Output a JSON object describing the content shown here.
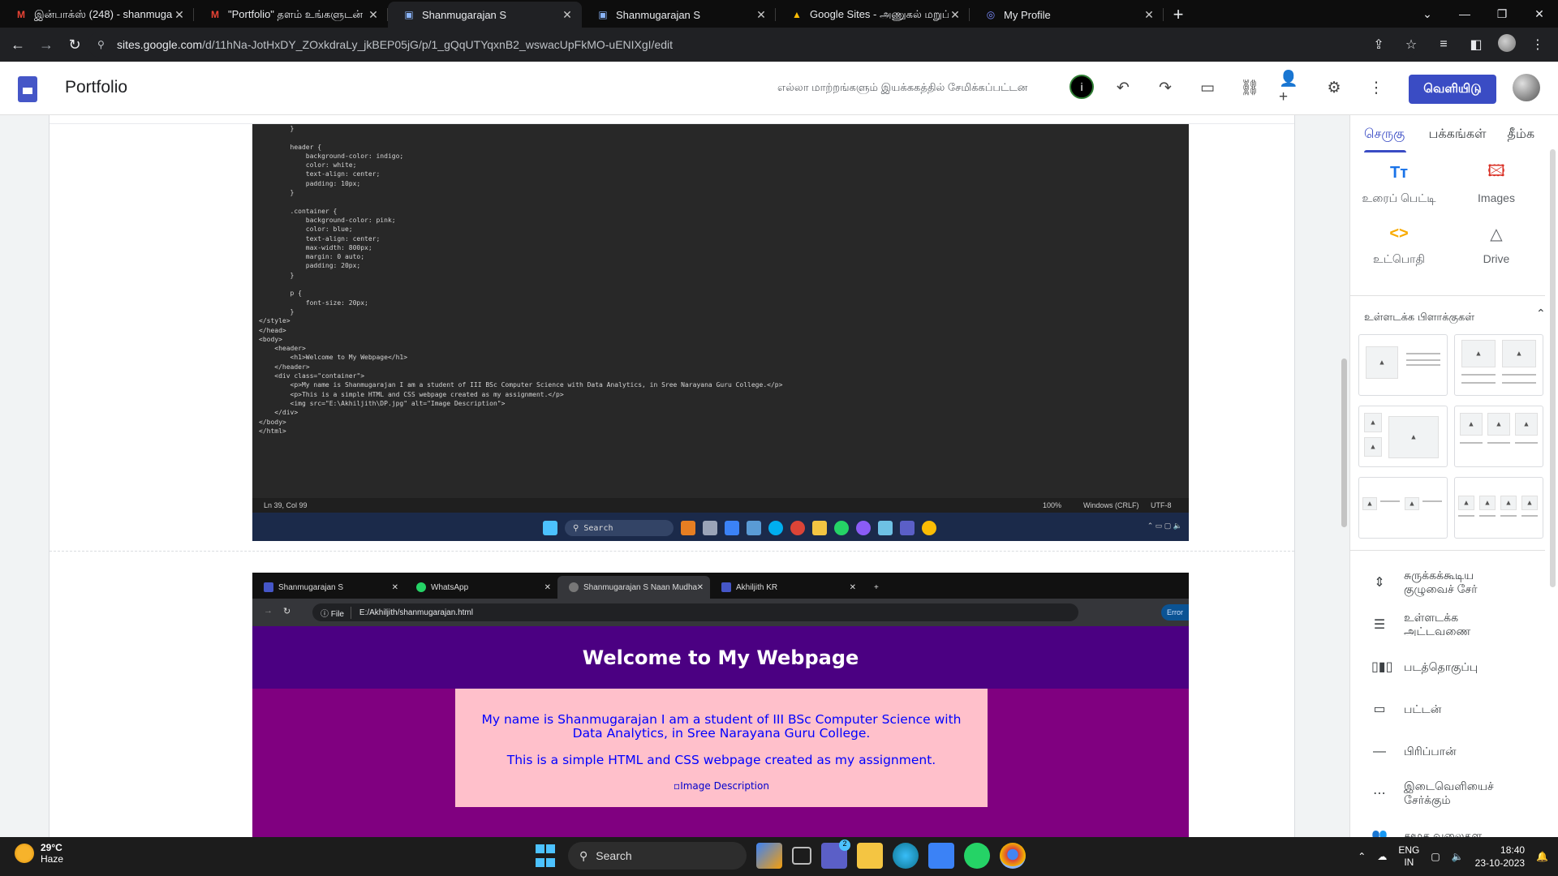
{
  "browser": {
    "tabs": [
      {
        "title": "இன்பாக்ஸ் (248) - shanmugara",
        "icon": "gmail-icon",
        "active": false
      },
      {
        "title": "\"Portfolio\" தளம் உங்களுடன்",
        "icon": "gmail-icon",
        "active": false
      },
      {
        "title": "Shanmugarajan S",
        "icon": "google-sites-icon",
        "active": true
      },
      {
        "title": "Shanmugarajan S",
        "icon": "google-sites-icon",
        "active": false
      },
      {
        "title": "Google Sites - அணுகல் மறுப்",
        "icon": "google-drive-icon",
        "active": false
      },
      {
        "title": "My Profile",
        "icon": "profile-icon",
        "active": false
      }
    ],
    "url_domain": "sites.google.com",
    "url_path": "/d/11hNa-JotHxDY_ZOxkdraLy_jkBEP05jG/p/1_gQqUTYqxnB2_wswacUpFkMO-uENIXgI/edit"
  },
  "sites": {
    "site_name": "Portfolio",
    "saved_status": "எல்லா மாற்றங்களும் இயக்ககத்தில் சேமிக்கப்பட்டன",
    "publish_label": "வெளியிடு"
  },
  "code_screenshot": {
    "lines": [
      "        }",
      "",
      "        header {",
      "            background-color: indigo;",
      "            color: white;",
      "            text-align: center;",
      "            padding: 10px;",
      "        }",
      "",
      "        .container {",
      "            background-color: pink;",
      "            color: blue;",
      "            text-align: center;",
      "            max-width: 800px;",
      "            margin: 0 auto;",
      "            padding: 20px;",
      "        }",
      "",
      "        p {",
      "            font-size: 20px;",
      "        }",
      "</style>",
      "</head>",
      "<body>",
      "    <header>",
      "        <h1>Welcome to My Webpage</h1>",
      "    </header>",
      "    <div class=\"container\">",
      "        <p>My name is Shanmugarajan I am a student of III BSc Computer Science with Data Analytics, in Sree Narayana Guru College.</p>",
      "        <p>This is a simple HTML and CSS webpage created as my assignment.</p>",
      "        <img src=\"E:\\Akhiljith\\DP.jpg\" alt=\"Image Description\">",
      "    </div>",
      "</body>",
      "</html>"
    ],
    "status_position": "Ln 39, Col 99",
    "status_zoom": "100%",
    "status_eol": "Windows (CRLF)",
    "status_encoding": "UTF-8",
    "taskbar_search": "Search"
  },
  "browser_screenshot": {
    "tabs": [
      "Shanmugarajan S",
      "WhatsApp",
      "Shanmugarajan S Naan Mudhalvan",
      "Akhiljith KR"
    ],
    "file_label": "File",
    "url": "E:/Akhiljith/shanmugarajan.html",
    "error_label": "Error",
    "heading": "Welcome to My Webpage",
    "paragraph1": "My name is Shanmugarajan I am a student of III BSc Computer Science with Data Analytics, in Sree Narayana Guru College.",
    "paragraph2": "This is a simple HTML and CSS webpage created as my assignment.",
    "img_alt": "Image Description",
    "colors": {
      "header": "#4b0082",
      "body": "#800080",
      "container": "#ffc0cb",
      "text": "#0000ff"
    }
  },
  "sidebar": {
    "tabs": [
      "செருகு",
      "பக்கங்கள்",
      "தீம்க"
    ],
    "insert_items": [
      {
        "label": "உரைப் பெட்டி",
        "icon": "text-box-icon"
      },
      {
        "label": "Images",
        "icon": "image-icon"
      },
      {
        "label": "உட்பொதி",
        "icon": "embed-icon"
      },
      {
        "label": "Drive",
        "icon": "drive-icon"
      }
    ],
    "content_blocks_heading": "உள்ளடக்க பிளாக்குகள்",
    "list_items": [
      {
        "label": "சுருக்கக்கூடிய குழுவைச் சேர்",
        "icon": "collapsible-icon"
      },
      {
        "label": "உள்ளடக்க அட்டவணை",
        "icon": "toc-icon"
      },
      {
        "label": "படத்தொகுப்பு",
        "icon": "carousel-icon"
      },
      {
        "label": "பட்டன்",
        "icon": "button-icon"
      },
      {
        "label": "பிரிப்பான்",
        "icon": "divider-icon"
      },
      {
        "label": "இடைவெளியைச் சேர்க்கும்",
        "icon": "spacer-icon"
      },
      {
        "label": "சமூக வலைதள",
        "icon": "social-icon"
      }
    ],
    "accent_color": "#3a4cc4"
  },
  "taskbar": {
    "temperature": "29°C",
    "weather": "Haze",
    "search": "Search",
    "language_line1": "ENG",
    "language_line2": "IN",
    "time": "18:40",
    "date": "23-10-2023",
    "chat_badge": "2"
  }
}
